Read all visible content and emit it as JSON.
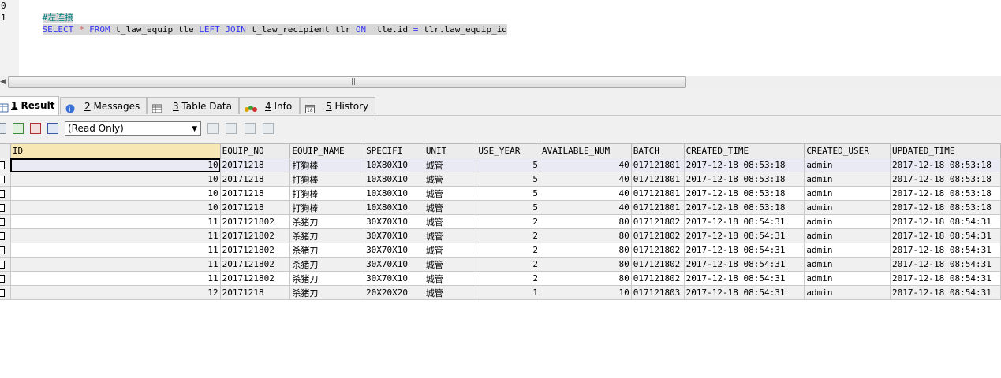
{
  "editor": {
    "line_numbers": [
      "0",
      "1"
    ],
    "comment": "#左连接",
    "sql": {
      "select": "SELECT",
      "star": "*",
      "from": "FROM",
      "table1": "t_law_equip tle",
      "left_join": "LEFT JOIN",
      "table2": "t_law_recipient tlr",
      "on": "ON",
      "condition_left": " tle.id",
      "equals": "=",
      "condition_right": "tlr.law_equip_id"
    }
  },
  "tabs": [
    {
      "num": "1",
      "label": " Result",
      "active": true
    },
    {
      "num": "2",
      "label": " Messages",
      "active": false
    },
    {
      "num": "3",
      "label": " Table Data",
      "active": false
    },
    {
      "num": "4",
      "label": " Info",
      "active": false
    },
    {
      "num": "5",
      "label": " History",
      "active": false
    }
  ],
  "toolbar": {
    "mode": "(Read Only)"
  },
  "grid": {
    "columns": [
      "ID",
      "EQUIP_NO",
      "EQUIP_NAME",
      "SPECIFI",
      "UNIT",
      "USE_YEAR",
      "AVAILABLE_NUM",
      "BATCH",
      "CREATED_TIME",
      "CREATED_USER",
      "UPDATED_TIME"
    ],
    "rows": [
      [
        "10",
        "20171218",
        "打狗棒",
        "10X80X10",
        "城管",
        "5",
        "40",
        "017121801",
        "2017-12-18 08:53:18",
        "admin",
        "2017-12-18 08:53:18"
      ],
      [
        "10",
        "20171218",
        "打狗棒",
        "10X80X10",
        "城管",
        "5",
        "40",
        "017121801",
        "2017-12-18 08:53:18",
        "admin",
        "2017-12-18 08:53:18"
      ],
      [
        "10",
        "20171218",
        "打狗棒",
        "10X80X10",
        "城管",
        "5",
        "40",
        "017121801",
        "2017-12-18 08:53:18",
        "admin",
        "2017-12-18 08:53:18"
      ],
      [
        "10",
        "20171218",
        "打狗棒",
        "10X80X10",
        "城管",
        "5",
        "40",
        "017121801",
        "2017-12-18 08:53:18",
        "admin",
        "2017-12-18 08:53:18"
      ],
      [
        "11",
        "2017121802",
        "杀猪刀",
        "30X70X10",
        "城管",
        "2",
        "80",
        "017121802",
        "2017-12-18 08:54:31",
        "admin",
        "2017-12-18 08:54:31"
      ],
      [
        "11",
        "2017121802",
        "杀猪刀",
        "30X70X10",
        "城管",
        "2",
        "80",
        "017121802",
        "2017-12-18 08:54:31",
        "admin",
        "2017-12-18 08:54:31"
      ],
      [
        "11",
        "2017121802",
        "杀猪刀",
        "30X70X10",
        "城管",
        "2",
        "80",
        "017121802",
        "2017-12-18 08:54:31",
        "admin",
        "2017-12-18 08:54:31"
      ],
      [
        "11",
        "2017121802",
        "杀猪刀",
        "30X70X10",
        "城管",
        "2",
        "80",
        "017121802",
        "2017-12-18 08:54:31",
        "admin",
        "2017-12-18 08:54:31"
      ],
      [
        "11",
        "2017121802",
        "杀猪刀",
        "30X70X10",
        "城管",
        "2",
        "80",
        "017121802",
        "2017-12-18 08:54:31",
        "admin",
        "2017-12-18 08:54:31"
      ],
      [
        "12",
        "20171218",
        "杀猪刀",
        "20X20X20",
        "城管",
        "1",
        "10",
        "017121803",
        "2017-12-18 08:54:31",
        "admin",
        "2017-12-18 08:54:31"
      ]
    ],
    "numeric_columns": [
      0,
      5,
      6
    ]
  }
}
